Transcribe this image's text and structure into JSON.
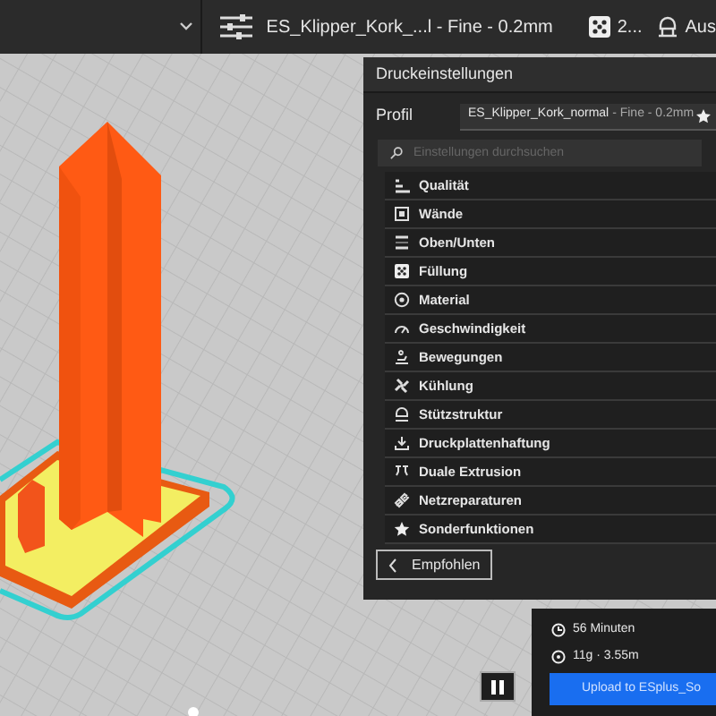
{
  "top_bar": {
    "profile_summary": "ES_Klipper_Kork_...l - Fine - 0.2mm",
    "infill_value": "2...",
    "support_value": "Aus"
  },
  "print_settings": {
    "title": "Druckeinstellungen",
    "profile_label": "Profil",
    "profile_name": "ES_Klipper_Kork_normal",
    "profile_detail": " - Fine - 0.2mm",
    "search_placeholder": "Einstellungen durchsuchen",
    "categories": [
      {
        "label": "Qualität"
      },
      {
        "label": "Wände"
      },
      {
        "label": "Oben/Unten"
      },
      {
        "label": "Füllung"
      },
      {
        "label": "Material"
      },
      {
        "label": "Geschwindigkeit"
      },
      {
        "label": "Bewegungen"
      },
      {
        "label": "Kühlung"
      },
      {
        "label": "Stützstruktur"
      },
      {
        "label": "Druckplattenhaftung"
      },
      {
        "label": "Duale Extrusion"
      },
      {
        "label": "Netzreparaturen"
      },
      {
        "label": "Sonderfunktionen"
      }
    ],
    "back_button": "Empfohlen"
  },
  "estimate": {
    "time": "56 Minuten",
    "material": "11g · 3.55m",
    "upload_button": "Upload to ESplus_So"
  }
}
